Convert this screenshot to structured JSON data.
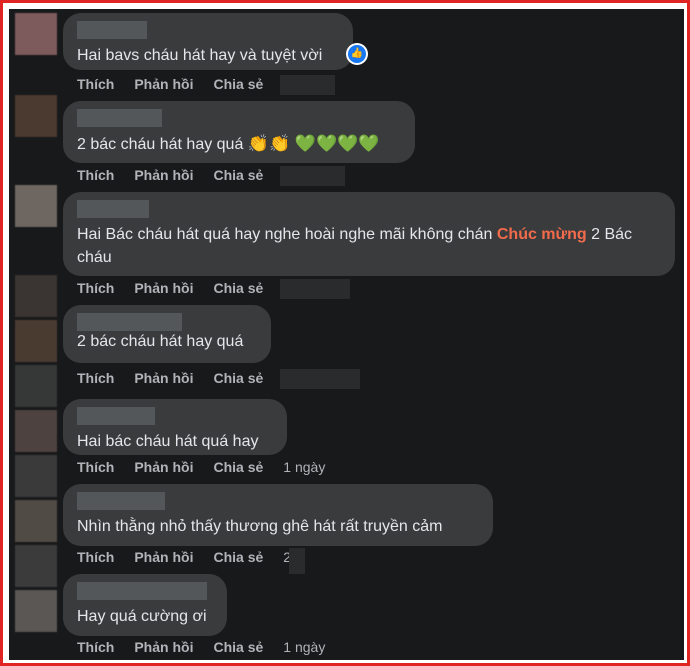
{
  "actions": {
    "like": "Thích",
    "reply": "Phản hồi",
    "share": "Chia sẻ"
  },
  "comments": [
    {
      "text": "Hai bavs cháu hát hay và tuyệt vời",
      "reaction_icon": "thumbs-up-icon",
      "time": ""
    },
    {
      "text": "2 bác cháu hát hay quá ",
      "emojis": "👏👏 💚💚💚💚",
      "time": ""
    },
    {
      "text_before": "Hai Bác cháu hát quá hay nghe hoài nghe mãi không chán ",
      "highlight": "Chúc mừng",
      "text_after": " 2 Bác cháu",
      "time": ""
    },
    {
      "text": "2 bác cháu hát hay quá",
      "time": ""
    },
    {
      "text": "Hai bác cháu hát quá hay",
      "time": "1 ngày"
    },
    {
      "text": "Nhìn thằng nhỏ thấy thương ghê hát rất truyền cảm",
      "time": "2"
    },
    {
      "text": "Hay quá cường ơi",
      "time": "1 ngày"
    }
  ],
  "colors": {
    "frame_border": "#e02424",
    "background": "#18191a",
    "bubble": "#3a3b3c",
    "text": "#e4e6eb",
    "action_text": "#b0b3b8",
    "highlight": "#f26b4d",
    "like_blue": "#1877f2"
  }
}
